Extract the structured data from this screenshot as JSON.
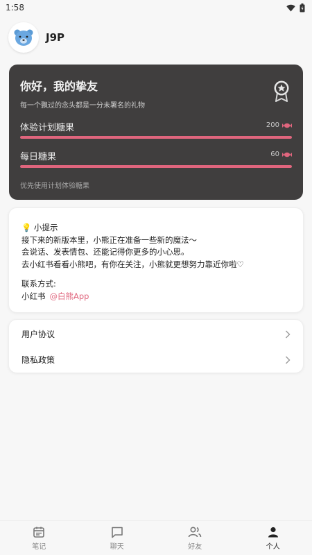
{
  "status": {
    "time": "1:58"
  },
  "profile": {
    "username": "J9P"
  },
  "candy_card": {
    "greeting": "你好，我的挚友",
    "subtitle": "每一个飘过的念头都是一分未署名的礼物",
    "plan_label": "体验计划糖果",
    "plan_value": "200",
    "plan_fill": 1.0,
    "daily_label": "每日糖果",
    "daily_value": "60",
    "daily_fill": 1.0,
    "note": "优先使用计划体验糖果",
    "accent": "#e0657d"
  },
  "tips": {
    "title": "小提示",
    "line1": "接下来的新版本里，小熊正在准备一些新的魔法～",
    "line2": "会说话、发表情包、还能记得你更多的小心思。",
    "line3": "去小红书看看小熊吧，有你在关注，小熊就更想努力靠近你啦♡",
    "contact_label": "联系方式:",
    "platform": "小红书",
    "handle": "@白熊App"
  },
  "menu": {
    "items": [
      {
        "label": "用户协议"
      },
      {
        "label": "隐私政策"
      }
    ]
  },
  "tabs": [
    {
      "label": "笔记",
      "icon": "calendar-icon"
    },
    {
      "label": "聊天",
      "icon": "chat-icon"
    },
    {
      "label": "好友",
      "icon": "friends-icon"
    },
    {
      "label": "个人",
      "icon": "person-icon"
    }
  ]
}
